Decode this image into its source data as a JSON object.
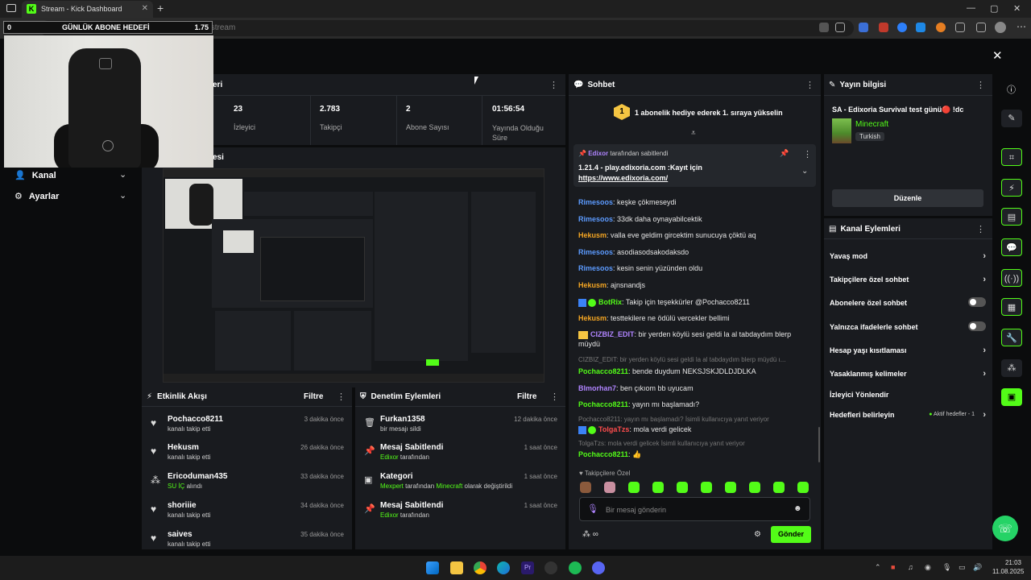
{
  "browser": {
    "tab_title": "Stream - Kick Dashboard",
    "tab_favicon_letter": "K",
    "url_text": "dashboard.kick.com/stream",
    "new_tab": "+",
    "win_min": "—",
    "win_max": "▢",
    "win_close": "✕",
    "close_dash": "✕"
  },
  "goal_overlay": {
    "left": "0",
    "title": "GÜNLÜK ABONE HEDEFİ",
    "right": "1.75"
  },
  "stats_header": {
    "title": "eri"
  },
  "stats": [
    {
      "value": "23",
      "label": "İzleyici"
    },
    {
      "value": "2.783",
      "label": "Takipçi"
    },
    {
      "value": "2",
      "label": "Abone Sayısı"
    },
    {
      "value": "01:56:54",
      "label": "Yayında Olduğu Süre"
    }
  ],
  "preview_header": {
    "title": "esi"
  },
  "sidebar": {
    "items": [
      {
        "label": "Kanal"
      },
      {
        "label": "Ayarlar"
      }
    ]
  },
  "chat": {
    "title": "Sohbet",
    "promo_text": "1 abonelik hediye ederek 1. sıraya yükselin",
    "promo_badge": "1",
    "pinned_by_name": "Edixor",
    "pinned_by_suffix": "tarafından sabitlendi",
    "pinned_message": "1.21.4 - play.edixoria.com :Kayıt için",
    "pinned_link": "https://www.edixoria.com/",
    "messages": [
      {
        "user": "Rimesoos",
        "color": "blue",
        "text": ": keşke çökmeseydi"
      },
      {
        "user": "Rimesoos",
        "color": "blue",
        "text": ": 33dk daha oynayabilcektik"
      },
      {
        "user": "Hekusm",
        "color": "orange",
        "text": ": valla eve geldim gircektim sunucuya çöktü aq"
      },
      {
        "user": "Rimesoos",
        "color": "blue",
        "text": ": asodiasodsakodaksdo"
      },
      {
        "user": "Rimesoos",
        "color": "blue",
        "text": ": kesin senin yüzünden oldu"
      },
      {
        "user": "Hekusm",
        "color": "orange",
        "text": ": ajnsnandjs"
      },
      {
        "user": "BotRix",
        "color": "green",
        "text": ": Takip için teşekkürler @Pochacco8211"
      },
      {
        "user": "Hekusm",
        "color": "orange",
        "text": ": testtekilere ne ödülü vercekler bellimi"
      },
      {
        "user": "CIZBIZ_EDIT",
        "color": "purple",
        "text": ": bir yerden köylü sesi geldi la al tabdaydım blerp müydü"
      },
      {
        "reply": "CIZBIZ_EDIT: bir yerden köylü sesi geldi la al tabdaydım blerp müydü ı..."
      },
      {
        "user": "Pochacco8211",
        "color": "green",
        "text": ": bende duydum NEKSJSKJDLDJDLKA"
      },
      {
        "user": "Blmorhan7",
        "color": "purple",
        "text": ": ben çıkıom bb uyucam"
      },
      {
        "user": "Pochacco8211",
        "color": "green",
        "text": ": yayın mı başlamadı?"
      },
      {
        "reply": "Pochacco8211: yayın mı başlamadı? İsimli kullanıcıya yanıt veriyor"
      },
      {
        "user": "TolgaTzs",
        "color": "red",
        "text": ": mola verdi gelicek"
      },
      {
        "reply": "TolgaTzs: mola verdi gelicek İsimli kullanıcıya yanıt veriyor"
      },
      {
        "user": "Pochacco8211",
        "color": "green",
        "text": ": 👍"
      }
    ],
    "emote_label": "Takipçilere Özel",
    "input_placeholder": "Bir mesaj gönderin",
    "send_label": "Gönder"
  },
  "stream_info": {
    "title": "Yayın bilgisi",
    "stream_title": "SA - Edixoria Survival test günü🔴 !dc",
    "category": "Minecraft",
    "language": "Turkish",
    "edit_label": "Düzenle"
  },
  "channel_actions": {
    "title": "Kanal Eylemleri",
    "items": [
      {
        "label": "Yavaş mod",
        "kind": "chevron"
      },
      {
        "label": "Takipçilere özel sohbet",
        "kind": "chevron"
      },
      {
        "label": "Abonelere özel sohbet",
        "kind": "toggle"
      },
      {
        "label": "Yalnızca ifadelerle sohbet",
        "kind": "toggle"
      },
      {
        "label": "Hesap yaşı kısıtlaması",
        "kind": "chevron"
      },
      {
        "label": "Yasaklanmış kelimeler",
        "kind": "chevron"
      },
      {
        "label": "İzleyici Yönlendir",
        "kind": "none"
      },
      {
        "label": "Hedefleri belirleyin",
        "kind": "chevron",
        "badge": "Aktif hedefler - 1"
      }
    ]
  },
  "activity": {
    "title": "Etkinlik Akışı",
    "filter_label": "Filtre",
    "items": [
      {
        "name": "Pochacco8211",
        "sub": "kanalı takip etti",
        "time": "3 dakika önce",
        "icon": "heart"
      },
      {
        "name": "Hekusm",
        "sub": "kanalı takip etti",
        "time": "26 dakika önce",
        "icon": "heart"
      },
      {
        "name": "Ericoduman435",
        "sub_green": "SU İÇ",
        "sub": " alındı",
        "time": "33 dakika önce",
        "icon": "dots"
      },
      {
        "name": "shoriiie",
        "sub": "kanalı takip etti",
        "time": "34 dakika önce",
        "icon": "heart"
      },
      {
        "name": "saives",
        "sub": "kanalı takip etti",
        "time": "35 dakika önce",
        "icon": "heart"
      }
    ]
  },
  "moderation": {
    "title": "Denetim Eylemleri",
    "filter_label": "Filtre",
    "items": [
      {
        "name": "Furkan1358",
        "sub": "bir mesajı sildi",
        "time": "12 dakika önce",
        "icon": "trash"
      },
      {
        "name": "Mesaj Sabitlendi",
        "sub_green": "Edixor",
        "sub": " tarafından",
        "time": "1 saat önce",
        "icon": "pin"
      },
      {
        "name": "Kategori",
        "sub_green": "Mexpert",
        "sub": " tarafından ",
        "sub_green2": "Minecraft",
        "sub2": " olarak değiştirildi",
        "time": "1 saat önce",
        "icon": "category"
      },
      {
        "name": "Mesaj Sabitlendi",
        "sub_green": "Edixor",
        "sub": " tarafından",
        "time": "1 saat önce",
        "icon": "pin"
      }
    ]
  },
  "taskbar": {
    "time": "21:03",
    "date": "11.08.2025"
  },
  "colors": {
    "accent": "#53fc18",
    "panel": "#191b1f",
    "background": "#0b0c0d"
  }
}
